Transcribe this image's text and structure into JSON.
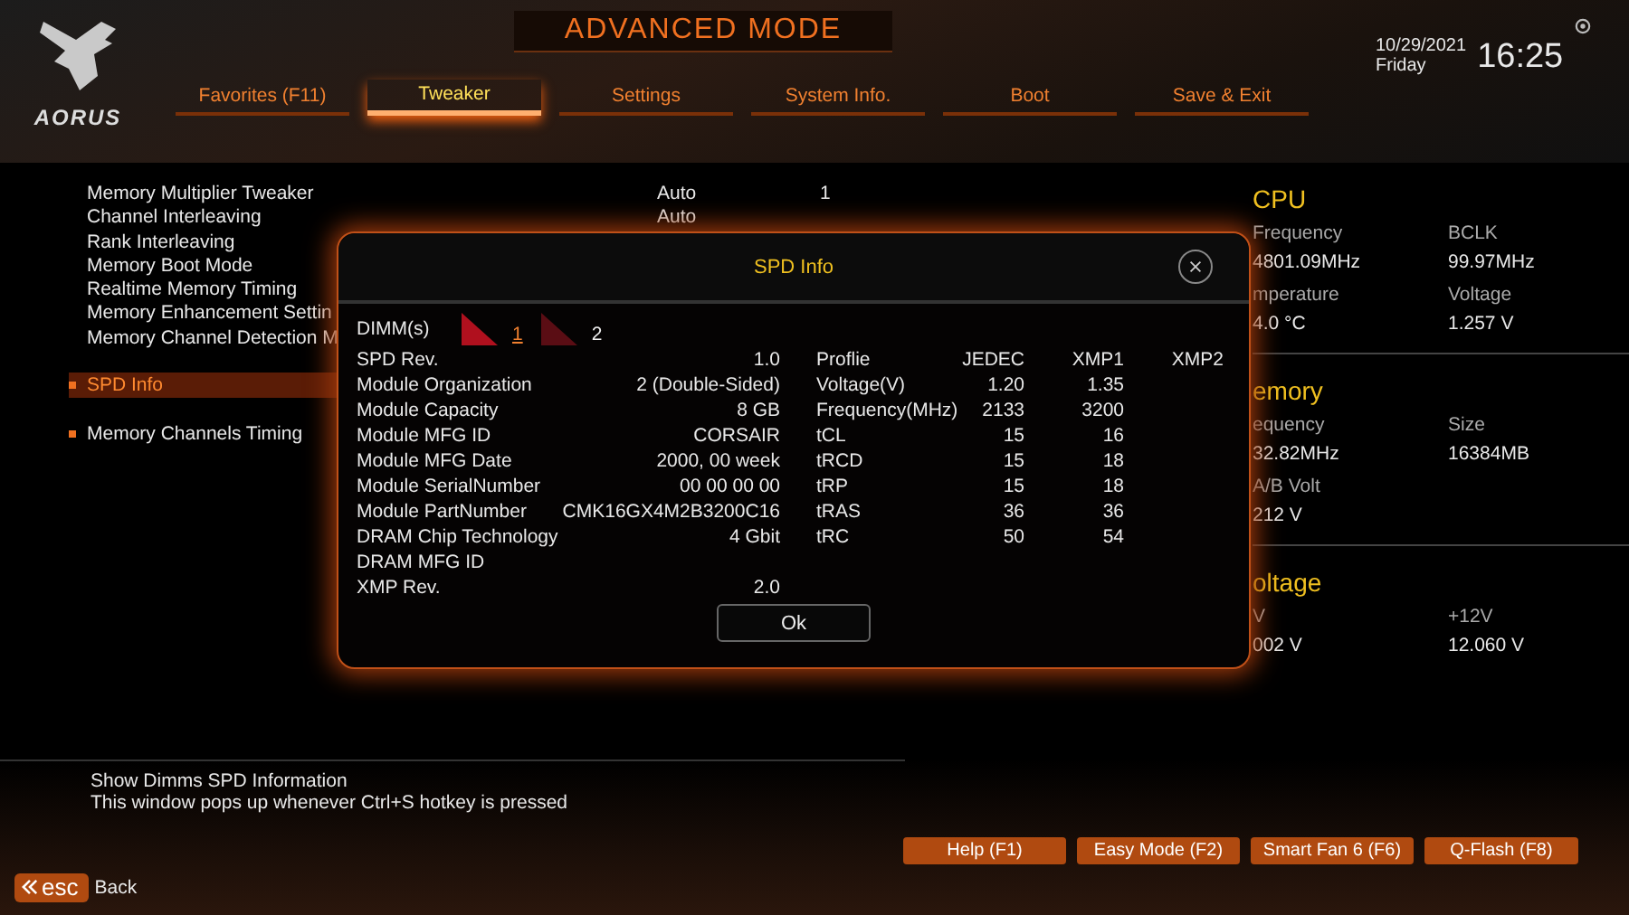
{
  "header": {
    "title": "ADVANCED MODE",
    "logo": "AORUS",
    "date": "10/29/2021",
    "day": "Friday",
    "time": "16:25"
  },
  "tabs": [
    {
      "label": "Favorites (F11)",
      "selected": false
    },
    {
      "label": "Tweaker",
      "selected": true
    },
    {
      "label": "Settings",
      "selected": false
    },
    {
      "label": "System Info.",
      "selected": false
    },
    {
      "label": "Boot",
      "selected": false
    },
    {
      "label": "Save & Exit",
      "selected": false
    }
  ],
  "settings": [
    {
      "kind": "setting",
      "label": "Memory Multiplier Tweaker",
      "value": "Auto",
      "extra": "1"
    },
    {
      "kind": "setting",
      "label": "Channel Interleaving",
      "value": "Auto"
    },
    {
      "kind": "setting",
      "label": "Rank Interleaving"
    },
    {
      "kind": "setting",
      "label": "Memory Boot Mode"
    },
    {
      "kind": "setting",
      "label": "Realtime Memory Timing"
    },
    {
      "kind": "setting",
      "label": "Memory Enhancement Settin"
    },
    {
      "kind": "setting",
      "label": "Memory Channel Detection M"
    },
    {
      "kind": "submenu",
      "label": "SPD Info",
      "selected": true
    },
    {
      "kind": "submenu",
      "label": "Memory Channels Timing",
      "selected": false
    }
  ],
  "monitor": [
    {
      "title": "CPU",
      "fields": [
        {
          "label": "Frequency",
          "value": "4801.09MHz"
        },
        {
          "label": "BCLK",
          "value": "99.97MHz"
        },
        {
          "label": "mperature",
          "value": "4.0 °C"
        },
        {
          "label": "Voltage",
          "value": "1.257 V"
        }
      ]
    },
    {
      "title": "emory",
      "fields": [
        {
          "label": "equency",
          "value": "32.82MHz"
        },
        {
          "label": "Size",
          "value": "16384MB"
        },
        {
          "label": "A/B Volt",
          "value": "212 V"
        }
      ]
    },
    {
      "title": "oltage",
      "fields": [
        {
          "label": "V",
          "value": "002 V"
        },
        {
          "label": "+12V",
          "value": "12.060 V"
        }
      ]
    }
  ],
  "dialog": {
    "title": "SPD Info",
    "dimm_label": "DIMM(s)",
    "dimms": [
      {
        "label": "1",
        "selected": true
      },
      {
        "label": "2",
        "selected": false
      }
    ],
    "info": [
      {
        "label": "SPD Rev.",
        "value": "1.0"
      },
      {
        "label": "Module Organization",
        "value": "2 (Double-Sided)"
      },
      {
        "label": "Module Capacity",
        "value": "8 GB"
      },
      {
        "label": "Module MFG ID",
        "value": "CORSAIR"
      },
      {
        "label": "Module MFG Date",
        "value": "2000, 00 week"
      },
      {
        "label": "Module SerialNumber",
        "value": "00 00 00 00"
      },
      {
        "label": "Module PartNumber",
        "value": "CMK16GX4M2B3200C16"
      },
      {
        "label": "DRAM Chip Technology",
        "value": "4 Gbit"
      },
      {
        "label": "DRAM MFG ID"
      },
      {
        "label": "XMP Rev.",
        "value": "2.0"
      }
    ],
    "profile_columns": [
      "Proflie",
      "JEDEC",
      "XMP1",
      "XMP2"
    ],
    "profile_rows": [
      [
        "Voltage(V)",
        "1.20",
        "1.35"
      ],
      [
        "Frequency(MHz)",
        "2133",
        "3200"
      ],
      [
        "tCL",
        "15",
        "16"
      ],
      [
        "tRCD",
        "15",
        "18"
      ],
      [
        "tRP",
        "15",
        "18"
      ],
      [
        "tRAS",
        "36",
        "36"
      ],
      [
        "tRC",
        "50",
        "54"
      ]
    ],
    "ok": "Ok"
  },
  "help": [
    "Show Dimms SPD Information",
    "This window pops up whenever Ctrl+S hotkey is pressed"
  ],
  "buttons": [
    "Help (F1)",
    "Easy Mode (F2)",
    "Smart Fan 6 (F6)",
    "Q-Flash (F8)"
  ],
  "esc": {
    "key": "esc",
    "label": "Back"
  }
}
